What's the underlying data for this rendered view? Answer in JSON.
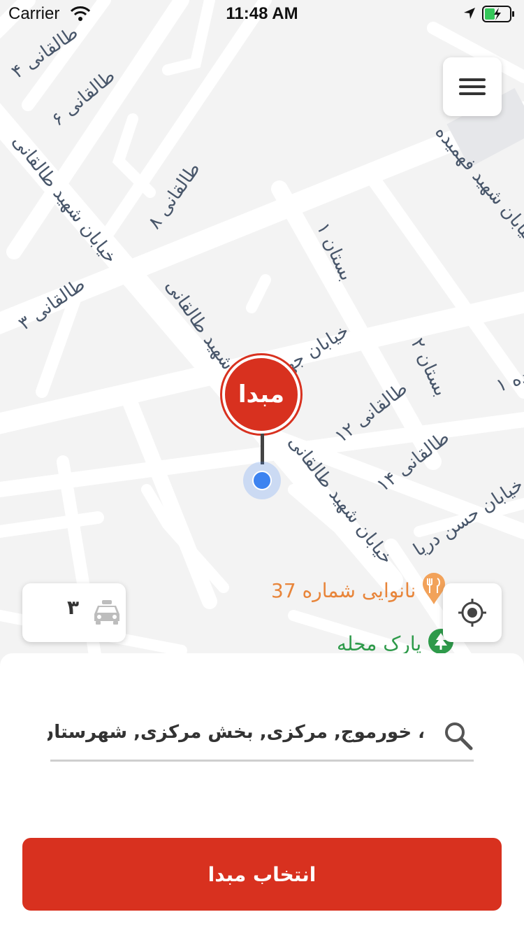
{
  "status_bar": {
    "carrier": "Carrier",
    "time": "11:48 AM"
  },
  "map": {
    "streets": [
      "طالقانی ۴",
      "طالقانی ۶",
      "خیابان شهید طالقانی",
      "طالقانی ۸",
      "خیابان شهید فهمیده",
      "بستان ۱",
      "طالقانی ۳",
      "خیابان شهید طالقانی",
      "خیابان جها",
      "بستان ۲",
      "ده ۱",
      "طالقانی ۱۲",
      "طالقانی ۱۴",
      "خیابان شهید طالقانی",
      "خیابان حسن دریا"
    ],
    "pois": [
      {
        "name": "نانوایی شماره 37",
        "color": "#e8853a",
        "icon": "restaurant-icon"
      },
      {
        "name": "پارک محله",
        "color": "#2e9a4a",
        "icon": "tree-icon"
      }
    ],
    "pin_label": "مبدا",
    "taxi_count": "۳"
  },
  "search": {
    "value": "، خورموج, مرکزی, بخش مرکزی, شهرستان دشتی, استان بوشهر"
  },
  "primary_button": {
    "label": "انتخاب مبدا"
  },
  "colors": {
    "accent": "#d8311f",
    "location_dot": "#3d83f0",
    "map_background": "#f3f3f3"
  }
}
